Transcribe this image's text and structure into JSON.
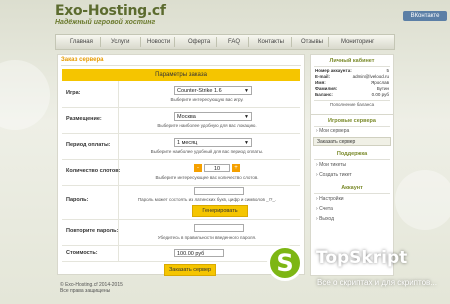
{
  "header": {
    "logo": "Exo-Hosting.cf",
    "tagline": "Надёжный игровой хостинг",
    "vk_label": "ВКонтакте"
  },
  "nav": [
    "Главная",
    "Услуги",
    "Новости",
    "Оферта",
    "FAQ",
    "Контакты",
    "Отзывы",
    "Мониторинг"
  ],
  "order": {
    "title": "Заказ сервера",
    "table_header": "Параметры заказа",
    "game_label": "Игра:",
    "game_value": "Counter-Strike 1.6",
    "game_hint": "Выберите интересующую вас игру.",
    "location_label": "Размещение:",
    "location_value": "Москва",
    "location_hint": "Выберите наиболее удобную для вас локацию.",
    "period_label": "Период оплаты:",
    "period_value": "1 месяц",
    "period_hint": "Выберите наиболее удобный для вас период оплаты.",
    "slots_label": "Количество слотов:",
    "slots_value": "10",
    "slots_minus": "-",
    "slots_plus": "+",
    "slots_hint": "Выберите интересующее вас количество слотов.",
    "password_label": "Пароль:",
    "password_hint": "Пароль может состоять из латинских букв, цифр и символов _!?_.",
    "generate_button": "Генерировать",
    "repeat_label": "Повторите пароль:",
    "repeat_hint": "Убедитесь в правильности введенного пароля.",
    "cost_label": "Стоимость:",
    "cost_value": "100.00 руб",
    "submit_button": "Заказать сервер"
  },
  "cabinet": {
    "title": "Личный кабинет",
    "rows": [
      {
        "k": "Номер аккаунта:",
        "v": "5"
      },
      {
        "k": "E-mail:",
        "v": "admin@lvelood.ru"
      },
      {
        "k": "Имя:",
        "v": "Ярослав"
      },
      {
        "k": "Фамилия:",
        "v": "Бутин"
      },
      {
        "k": "Баланс:",
        "v": "0.00 руб"
      }
    ],
    "topup": "Пополнение баланса"
  },
  "game_servers": {
    "title": "Игровые сервера",
    "items": [
      "Мои сервера",
      "Заказать сервер"
    ]
  },
  "support": {
    "title": "Поддержка",
    "items": [
      "Мои тикеты",
      "Создать тикет"
    ]
  },
  "account": {
    "title": "Аккаунт",
    "items": [
      "Настройки",
      "Счета",
      "Выход"
    ]
  },
  "footer": {
    "line1": "© Exo-Hosting.cf 2014-2015",
    "line2": "Все права защищены"
  },
  "watermark": {
    "badge": "S",
    "name": "TopSkript",
    "tagline": "Все о скриптах и для скриптов..."
  },
  "colors": {
    "accent": "#f5c500",
    "orange": "#f5a000",
    "green": "#7db614"
  }
}
